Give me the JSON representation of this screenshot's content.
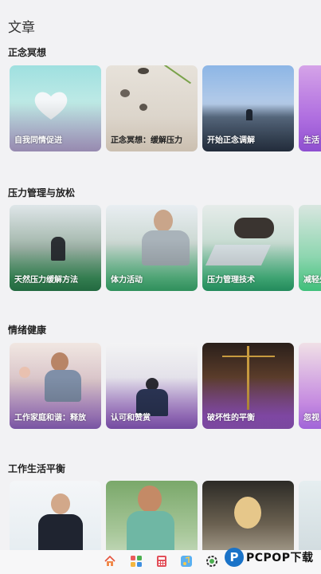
{
  "header": {
    "title": "文章"
  },
  "sections": [
    {
      "title": "正念冥想",
      "cards": [
        "自我同情促进",
        "正念冥想：缓解压力",
        "开始正念调解",
        "生活"
      ]
    },
    {
      "title": "压力管理与放松",
      "cards": [
        "天然压力缓解方法",
        "体力活动",
        "压力管理技术",
        "减轻处"
      ]
    },
    {
      "title": "情绪健康",
      "cards": [
        "工作家庭和谐：释放",
        "认可和赞赏",
        "破坏性的平衡",
        "忽视"
      ]
    },
    {
      "title": "工作生活平衡",
      "cards": [
        "",
        "",
        "",
        ""
      ]
    }
  ],
  "bottom_nav": {
    "items": [
      "home-icon",
      "apps-icon",
      "calculator-icon",
      "music-icon",
      "settings-icon"
    ]
  },
  "brand": {
    "logo_letter": "P",
    "text": "PCPOP下载"
  }
}
